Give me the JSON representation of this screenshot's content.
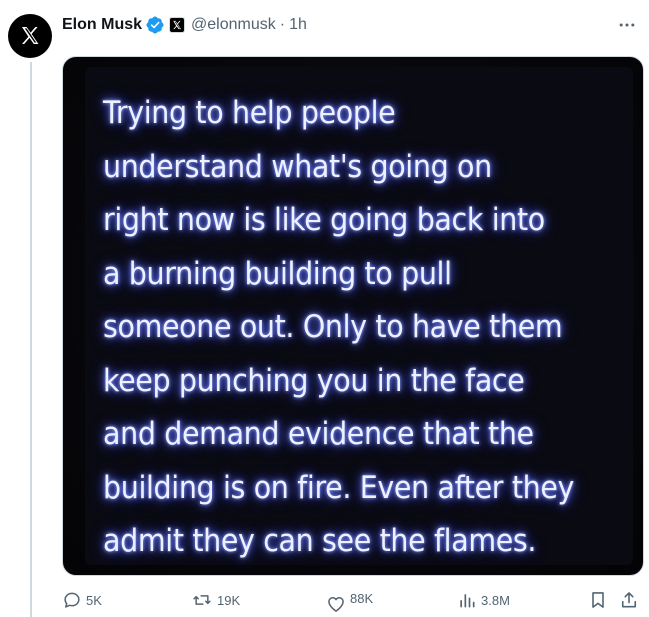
{
  "author": {
    "name": "Elon Musk",
    "handle": "@elonmusk",
    "separator": "·",
    "time": "1h",
    "avatar_icon": "x-logo-icon",
    "verified_color": "#1d9bf0"
  },
  "post": {
    "media_lines": [
      "Trying to help people",
      "understand what's going on",
      "right now is like going back into",
      "a burning building to pull",
      "someone out. Only to have them",
      "keep punching you in the face",
      "and demand evidence that the",
      "building is on fire. Even after they",
      "admit they can see the flames."
    ]
  },
  "actions": {
    "replies": "5K",
    "reposts": "19K",
    "likes": "88K",
    "views": "3.8M"
  },
  "colors": {
    "muted": "#536471",
    "text": "#0f1419",
    "glow": "#5b6cff"
  }
}
